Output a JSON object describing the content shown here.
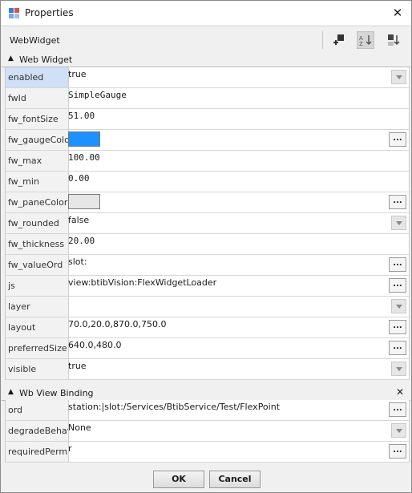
{
  "window": {
    "title": "Properties"
  },
  "header": {
    "object_name": "WebWidget"
  },
  "sections": [
    {
      "label": "Web Widget",
      "rows": [
        {
          "name": "enabled",
          "value": "true",
          "kind": "dropdown",
          "selected": true
        },
        {
          "name": "fwId",
          "value": "SimpleGauge",
          "kind": "text-mono"
        },
        {
          "name": "fw_fontSize",
          "value": "51.00",
          "kind": "text-mono"
        },
        {
          "name": "fw_gaugeColor",
          "value": "",
          "kind": "color",
          "color": "#1e90ff"
        },
        {
          "name": "fw_max",
          "value": "100.00",
          "kind": "text-mono"
        },
        {
          "name": "fw_min",
          "value": "0.00",
          "kind": "text-mono"
        },
        {
          "name": "fw_paneColor",
          "value": "",
          "kind": "color",
          "color": "#e6e6e6"
        },
        {
          "name": "fw_rounded",
          "value": "false",
          "kind": "dropdown"
        },
        {
          "name": "fw_thickness",
          "value": "20.00",
          "kind": "text-mono"
        },
        {
          "name": "fw_valueOrd",
          "value": "slot:",
          "kind": "ellipsis"
        },
        {
          "name": "js",
          "value": "view:btibVision:FlexWidgetLoader",
          "kind": "ellipsis"
        },
        {
          "name": "layer",
          "value": "",
          "kind": "dropdown"
        },
        {
          "name": "layout",
          "value": "70.0,20.0,870.0,750.0",
          "kind": "ellipsis"
        },
        {
          "name": "preferredSize",
          "value": "640.0,480.0",
          "kind": "ellipsis"
        },
        {
          "name": "visible",
          "value": "true",
          "kind": "dropdown"
        }
      ]
    },
    {
      "label": "Wb View Binding",
      "rows": [
        {
          "name": "ord",
          "value": "station:|slot:/Services/BtibService/Test/FlexPoint",
          "kind": "ellipsis"
        },
        {
          "name": "degradeBehavior",
          "value": "None",
          "kind": "dropdown"
        },
        {
          "name": "requiredPermissions",
          "value": "r",
          "kind": "ellipsis"
        }
      ]
    }
  ],
  "buttons": {
    "ok": "OK",
    "cancel": "Cancel",
    "ellipsis": "..."
  },
  "icons": {
    "close": "close-icon",
    "collapse": "collapse-arrow-icon",
    "remove": "remove-section-icon"
  }
}
